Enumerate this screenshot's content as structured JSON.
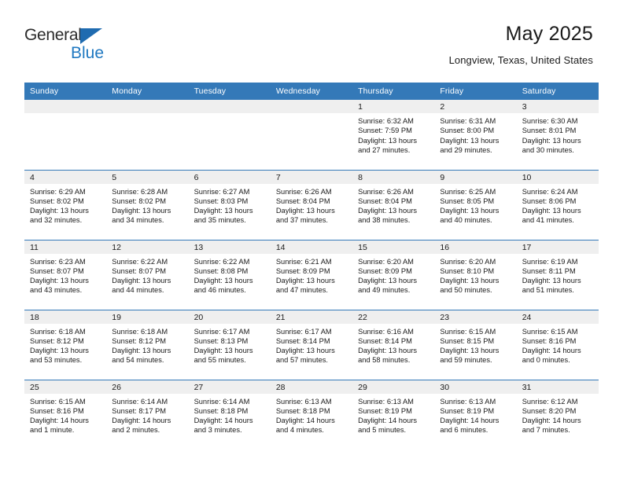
{
  "brand": {
    "name_part1": "General",
    "name_part2": "Blue",
    "accent_color": "#1f78c1",
    "triangle_color": "#1f6bb0",
    "logo_icon": "triangle-icon"
  },
  "header": {
    "title": "May 2025",
    "subtitle": "Longview, Texas, United States"
  },
  "calendar": {
    "header_color": "#3479b8",
    "daynum_band_color": "#efefef",
    "weekday_headers": [
      "Sunday",
      "Monday",
      "Tuesday",
      "Wednesday",
      "Thursday",
      "Friday",
      "Saturday"
    ],
    "weeks": [
      [
        {
          "day": "",
          "sunrise": "",
          "sunset": "",
          "daylight_line1": "",
          "daylight_line2": ""
        },
        {
          "day": "",
          "sunrise": "",
          "sunset": "",
          "daylight_line1": "",
          "daylight_line2": ""
        },
        {
          "day": "",
          "sunrise": "",
          "sunset": "",
          "daylight_line1": "",
          "daylight_line2": ""
        },
        {
          "day": "",
          "sunrise": "",
          "sunset": "",
          "daylight_line1": "",
          "daylight_line2": ""
        },
        {
          "day": "1",
          "sunrise": "Sunrise: 6:32 AM",
          "sunset": "Sunset: 7:59 PM",
          "daylight_line1": "Daylight: 13 hours",
          "daylight_line2": "and 27 minutes."
        },
        {
          "day": "2",
          "sunrise": "Sunrise: 6:31 AM",
          "sunset": "Sunset: 8:00 PM",
          "daylight_line1": "Daylight: 13 hours",
          "daylight_line2": "and 29 minutes."
        },
        {
          "day": "3",
          "sunrise": "Sunrise: 6:30 AM",
          "sunset": "Sunset: 8:01 PM",
          "daylight_line1": "Daylight: 13 hours",
          "daylight_line2": "and 30 minutes."
        }
      ],
      [
        {
          "day": "4",
          "sunrise": "Sunrise: 6:29 AM",
          "sunset": "Sunset: 8:02 PM",
          "daylight_line1": "Daylight: 13 hours",
          "daylight_line2": "and 32 minutes."
        },
        {
          "day": "5",
          "sunrise": "Sunrise: 6:28 AM",
          "sunset": "Sunset: 8:02 PM",
          "daylight_line1": "Daylight: 13 hours",
          "daylight_line2": "and 34 minutes."
        },
        {
          "day": "6",
          "sunrise": "Sunrise: 6:27 AM",
          "sunset": "Sunset: 8:03 PM",
          "daylight_line1": "Daylight: 13 hours",
          "daylight_line2": "and 35 minutes."
        },
        {
          "day": "7",
          "sunrise": "Sunrise: 6:26 AM",
          "sunset": "Sunset: 8:04 PM",
          "daylight_line1": "Daylight: 13 hours",
          "daylight_line2": "and 37 minutes."
        },
        {
          "day": "8",
          "sunrise": "Sunrise: 6:26 AM",
          "sunset": "Sunset: 8:04 PM",
          "daylight_line1": "Daylight: 13 hours",
          "daylight_line2": "and 38 minutes."
        },
        {
          "day": "9",
          "sunrise": "Sunrise: 6:25 AM",
          "sunset": "Sunset: 8:05 PM",
          "daylight_line1": "Daylight: 13 hours",
          "daylight_line2": "and 40 minutes."
        },
        {
          "day": "10",
          "sunrise": "Sunrise: 6:24 AM",
          "sunset": "Sunset: 8:06 PM",
          "daylight_line1": "Daylight: 13 hours",
          "daylight_line2": "and 41 minutes."
        }
      ],
      [
        {
          "day": "11",
          "sunrise": "Sunrise: 6:23 AM",
          "sunset": "Sunset: 8:07 PM",
          "daylight_line1": "Daylight: 13 hours",
          "daylight_line2": "and 43 minutes."
        },
        {
          "day": "12",
          "sunrise": "Sunrise: 6:22 AM",
          "sunset": "Sunset: 8:07 PM",
          "daylight_line1": "Daylight: 13 hours",
          "daylight_line2": "and 44 minutes."
        },
        {
          "day": "13",
          "sunrise": "Sunrise: 6:22 AM",
          "sunset": "Sunset: 8:08 PM",
          "daylight_line1": "Daylight: 13 hours",
          "daylight_line2": "and 46 minutes."
        },
        {
          "day": "14",
          "sunrise": "Sunrise: 6:21 AM",
          "sunset": "Sunset: 8:09 PM",
          "daylight_line1": "Daylight: 13 hours",
          "daylight_line2": "and 47 minutes."
        },
        {
          "day": "15",
          "sunrise": "Sunrise: 6:20 AM",
          "sunset": "Sunset: 8:09 PM",
          "daylight_line1": "Daylight: 13 hours",
          "daylight_line2": "and 49 minutes."
        },
        {
          "day": "16",
          "sunrise": "Sunrise: 6:20 AM",
          "sunset": "Sunset: 8:10 PM",
          "daylight_line1": "Daylight: 13 hours",
          "daylight_line2": "and 50 minutes."
        },
        {
          "day": "17",
          "sunrise": "Sunrise: 6:19 AM",
          "sunset": "Sunset: 8:11 PM",
          "daylight_line1": "Daylight: 13 hours",
          "daylight_line2": "and 51 minutes."
        }
      ],
      [
        {
          "day": "18",
          "sunrise": "Sunrise: 6:18 AM",
          "sunset": "Sunset: 8:12 PM",
          "daylight_line1": "Daylight: 13 hours",
          "daylight_line2": "and 53 minutes."
        },
        {
          "day": "19",
          "sunrise": "Sunrise: 6:18 AM",
          "sunset": "Sunset: 8:12 PM",
          "daylight_line1": "Daylight: 13 hours",
          "daylight_line2": "and 54 minutes."
        },
        {
          "day": "20",
          "sunrise": "Sunrise: 6:17 AM",
          "sunset": "Sunset: 8:13 PM",
          "daylight_line1": "Daylight: 13 hours",
          "daylight_line2": "and 55 minutes."
        },
        {
          "day": "21",
          "sunrise": "Sunrise: 6:17 AM",
          "sunset": "Sunset: 8:14 PM",
          "daylight_line1": "Daylight: 13 hours",
          "daylight_line2": "and 57 minutes."
        },
        {
          "day": "22",
          "sunrise": "Sunrise: 6:16 AM",
          "sunset": "Sunset: 8:14 PM",
          "daylight_line1": "Daylight: 13 hours",
          "daylight_line2": "and 58 minutes."
        },
        {
          "day": "23",
          "sunrise": "Sunrise: 6:15 AM",
          "sunset": "Sunset: 8:15 PM",
          "daylight_line1": "Daylight: 13 hours",
          "daylight_line2": "and 59 minutes."
        },
        {
          "day": "24",
          "sunrise": "Sunrise: 6:15 AM",
          "sunset": "Sunset: 8:16 PM",
          "daylight_line1": "Daylight: 14 hours",
          "daylight_line2": "and 0 minutes."
        }
      ],
      [
        {
          "day": "25",
          "sunrise": "Sunrise: 6:15 AM",
          "sunset": "Sunset: 8:16 PM",
          "daylight_line1": "Daylight: 14 hours",
          "daylight_line2": "and 1 minute."
        },
        {
          "day": "26",
          "sunrise": "Sunrise: 6:14 AM",
          "sunset": "Sunset: 8:17 PM",
          "daylight_line1": "Daylight: 14 hours",
          "daylight_line2": "and 2 minutes."
        },
        {
          "day": "27",
          "sunrise": "Sunrise: 6:14 AM",
          "sunset": "Sunset: 8:18 PM",
          "daylight_line1": "Daylight: 14 hours",
          "daylight_line2": "and 3 minutes."
        },
        {
          "day": "28",
          "sunrise": "Sunrise: 6:13 AM",
          "sunset": "Sunset: 8:18 PM",
          "daylight_line1": "Daylight: 14 hours",
          "daylight_line2": "and 4 minutes."
        },
        {
          "day": "29",
          "sunrise": "Sunrise: 6:13 AM",
          "sunset": "Sunset: 8:19 PM",
          "daylight_line1": "Daylight: 14 hours",
          "daylight_line2": "and 5 minutes."
        },
        {
          "day": "30",
          "sunrise": "Sunrise: 6:13 AM",
          "sunset": "Sunset: 8:19 PM",
          "daylight_line1": "Daylight: 14 hours",
          "daylight_line2": "and 6 minutes."
        },
        {
          "day": "31",
          "sunrise": "Sunrise: 6:12 AM",
          "sunset": "Sunset: 8:20 PM",
          "daylight_line1": "Daylight: 14 hours",
          "daylight_line2": "and 7 minutes."
        }
      ]
    ]
  }
}
